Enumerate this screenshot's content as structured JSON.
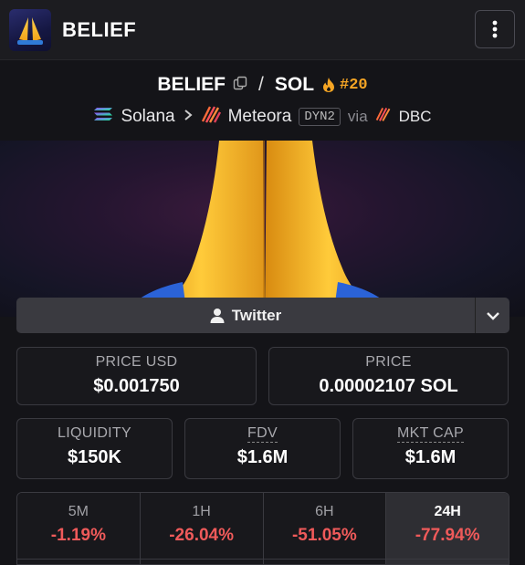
{
  "header": {
    "app_name": "BELIEF",
    "logo_icon": "praying-hands-icon",
    "menu_icon": "vertical-dots-icon"
  },
  "pair": {
    "base": "BELIEF",
    "quote": "SOL",
    "separator": "/",
    "rank": "#20",
    "rank_icon": "flame-icon",
    "copy_icon": "copy-icon",
    "chain": "Solana",
    "dex": "Meteora",
    "dex_tag": "DYN2",
    "via_label": "via",
    "launchpad": "DBC"
  },
  "banner": {
    "image": "praying-hands-emoji"
  },
  "socials": {
    "twitter_label": "Twitter",
    "dropdown_icon": "chevron-down-icon"
  },
  "stats": {
    "price_usd": {
      "label": "PRICE USD",
      "value": "$0.001750"
    },
    "price": {
      "label": "PRICE",
      "value": "0.00002107 SOL"
    },
    "liquidity": {
      "label": "LIQUIDITY",
      "value": "$150K"
    },
    "fdv": {
      "label": "FDV",
      "value": "$1.6M"
    },
    "mkt_cap": {
      "label": "MKT CAP",
      "value": "$1.6M"
    }
  },
  "changes": [
    {
      "period": "5M",
      "value": "-1.19%"
    },
    {
      "period": "1H",
      "value": "-26.04%"
    },
    {
      "period": "6H",
      "value": "-51.05%"
    },
    {
      "period": "24H",
      "value": "-77.94%"
    }
  ],
  "colors": {
    "negative": "#ef5a5a",
    "rank": "#f5a524",
    "background": "#141418"
  }
}
